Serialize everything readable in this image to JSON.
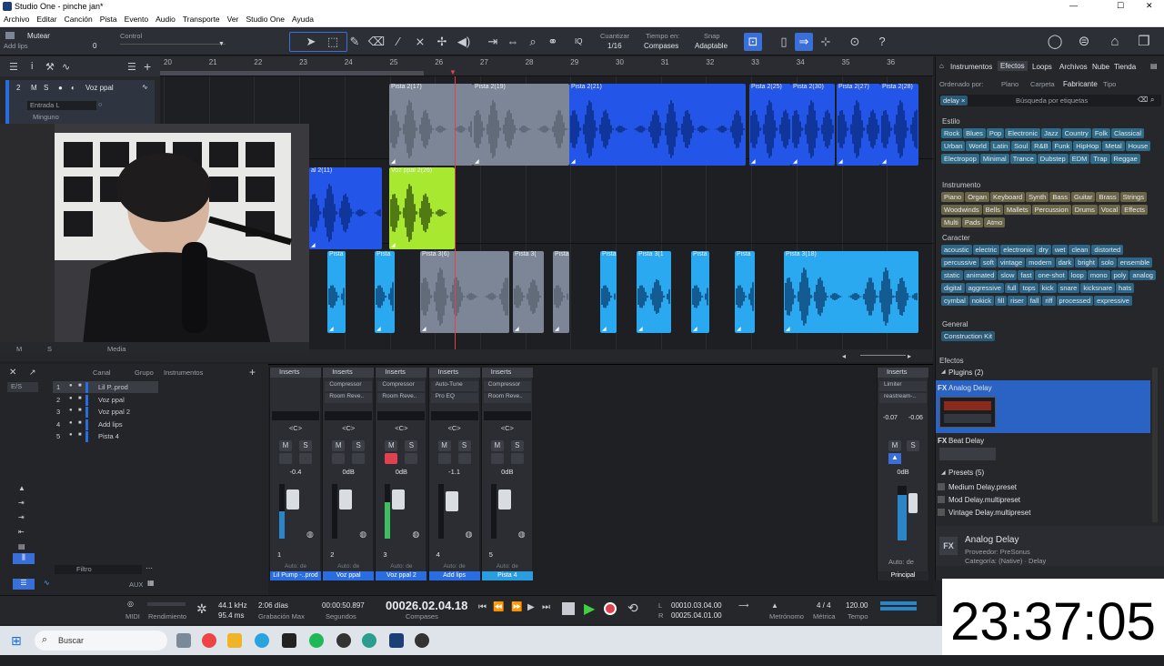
{
  "window": {
    "title": "Studio One - pinche jan*"
  },
  "window_controls": {
    "minimize": "—",
    "maximize": "☐",
    "close": "✕"
  },
  "menu": [
    "Archivo",
    "Editar",
    "Canción",
    "Pista",
    "Evento",
    "Audio",
    "Transporte",
    "Ver",
    "Studio One",
    "Ayuda"
  ],
  "toolbar": {
    "track_label": "Mutear",
    "track_sub": "Add lips",
    "track_val": "0",
    "control_label": "Control",
    "quantize_label": "Cuantizar",
    "quantize_val": "1/16",
    "timebase_label": "Tiempo en:",
    "timebase_val": "Compases",
    "snap_label": "Snap",
    "snap_val": "Adaptable",
    "iq": "IQ",
    "help": "?"
  },
  "track_header": {
    "num": "2",
    "mute": "M",
    "solo": "S",
    "name": "Voz ppal",
    "input": "Entrada L",
    "monitor": "Minguno",
    "bottom": [
      "M",
      "S",
      "Media"
    ]
  },
  "ruler": [
    "20",
    "21",
    "22",
    "23",
    "24",
    "25",
    "26",
    "27",
    "28",
    "29",
    "30",
    "31",
    "32",
    "33",
    "34",
    "35",
    "36"
  ],
  "clips": {
    "track1": [
      "Pista 2(17)",
      "Pista 2(19)",
      "Pista 2(21)",
      "Pista 2(25)",
      "Pista 2(30)",
      "Pista 2(27)",
      "Pista 2(28)"
    ],
    "track2": [
      "al 2(11)",
      "Voz ppal 2(26)"
    ],
    "track3": [
      "Pista",
      "Pista 3(6)",
      "Pista 3(",
      "Pista",
      "Pista 3(1",
      "Pista",
      "Pista",
      "Pista 3(18)"
    ]
  },
  "console_left": {
    "header_canal": "Canal",
    "header_grupo": "Grupo",
    "header_instr": "Instrumentos",
    "es": "E/S",
    "filter_placeholder": "Filtro",
    "aux": "AUX",
    "channels": [
      {
        "num": "1",
        "name": "Lil P..prod"
      },
      {
        "num": "2",
        "name": "Voz ppal"
      },
      {
        "num": "3",
        "name": "Voz ppal 2"
      },
      {
        "num": "4",
        "name": "Add lips"
      },
      {
        "num": "5",
        "name": "Pista 4"
      }
    ]
  },
  "strips": [
    {
      "num": "1",
      "name": "Lil Pump -..prod",
      "gain": "-0.4",
      "inserts": [],
      "color": "#2a6de0"
    },
    {
      "num": "2",
      "name": "Voz ppal",
      "gain": "0dB",
      "inserts": [
        "Compressor",
        "Room Reve.."
      ],
      "color": "#2a6de0"
    },
    {
      "num": "3",
      "name": "Voz ppal 2",
      "gain": "0dB",
      "inserts": [
        "Compressor",
        "Room Reve.."
      ],
      "color": "#2a6de0"
    },
    {
      "num": "4",
      "name": "Add lips",
      "gain": "-1.1",
      "inserts": [
        "Auto-Tune",
        "Pro EQ"
      ],
      "color": "#2a6de0"
    },
    {
      "num": "5",
      "name": "Pista 4",
      "gain": "0dB",
      "inserts": [
        "Compressor",
        "Room Reve.."
      ],
      "color": "#2a9de0"
    }
  ],
  "strip_common": {
    "inserts": "Inserts",
    "pan": "<C>",
    "mute": "M",
    "solo": "S",
    "auto": "Auto: de"
  },
  "master": {
    "inserts": "Inserts",
    "slots": [
      "Limiter",
      "reastream-.."
    ],
    "peak1": "-0.07",
    "peak2": "-0.06",
    "gain": "0dB",
    "name": "Principal",
    "auto": "Auto: de"
  },
  "browser": {
    "tabs": [
      "Instrumentos",
      "Efectos",
      "Loops",
      "Archivos",
      "Nube",
      "Tienda"
    ],
    "sort_label": "Ordenado por:",
    "sort_opts": [
      "Plano",
      "Carpeta",
      "Fabricante",
      "Tipo"
    ],
    "filter_tag": "delay ×",
    "search_placeholder": "Búsqueda por etiquetas",
    "estilo_label": "Estilo",
    "estilo": [
      "Rock",
      "Blues",
      "Pop",
      "Electronic",
      "Jazz",
      "Country",
      "Folk",
      "Classical",
      "Urban",
      "World",
      "Latin",
      "Soul",
      "R&B",
      "Funk",
      "HipHop",
      "Metal",
      "House",
      "Electropop",
      "Minimal",
      "Trance",
      "Dubstep",
      "EDM",
      "Trap",
      "Reggae"
    ],
    "instrumento_label": "Instrumento",
    "instrumento": [
      "Piano",
      "Organ",
      "Keyboard",
      "Synth",
      "Bass",
      "Guitar",
      "Brass",
      "Strings",
      "Woodwinds",
      "Bells",
      "Mallets",
      "Percussion",
      "Drums",
      "Vocal",
      "Effects",
      "Multi",
      "Pads",
      "Atmo"
    ],
    "caracter_label": "Caracter",
    "caracter": [
      "acoustic",
      "electric",
      "electronic",
      "dry",
      "wet",
      "clean",
      "distorted",
      "percussive",
      "soft",
      "vintage",
      "modern",
      "dark",
      "bright",
      "solo",
      "ensemble",
      "static",
      "animated",
      "slow",
      "fast",
      "one-shot",
      "loop",
      "mono",
      "poly",
      "analog",
      "digital",
      "aggressive",
      "full",
      "tops",
      "kick",
      "snare",
      "kicksnare",
      "hats",
      "cymbal",
      "nokick",
      "fill",
      "riser",
      "fall",
      "riff",
      "processed",
      "expressive"
    ],
    "general_label": "General",
    "general": [
      "Construction Kit"
    ],
    "efectos_label": "Efectos",
    "plugins_label": "Plugins (2)",
    "plugins": [
      "Analog Delay",
      "Beat Delay"
    ],
    "fx": "FX",
    "presets_label": "Presets (5)",
    "presets": [
      "Medium Delay.preset",
      "Mod Delay.multipreset",
      "Vintage Delay.multipreset"
    ],
    "info_name": "Analog Delay",
    "info_vendor": "Proveedor:   PreSonus",
    "info_cat": "Categoría:   (Native) · Delay"
  },
  "transport": {
    "midi": "MIDI",
    "rendimiento": "Rendimiento",
    "khz": "44.1 kHz",
    "ms": "95.4 ms",
    "dias": "2:06 días",
    "grabmax": "Grabación Max",
    "seconds": "00:00:50.897",
    "seconds_label": "Segundos",
    "position": "00026.02.04.18",
    "position_label": "Compases",
    "L": "L",
    "R": "R",
    "loop_l": "00010.03.04.00",
    "loop_r": "00025.04.01.00",
    "metronomo": "Metrónomo",
    "metrica": "Métrica",
    "metrica_val": "4 / 4",
    "tempo": "Tempo",
    "tempo_val": "120.00"
  },
  "taskbar": {
    "search": "Buscar"
  },
  "clock": "23:37:05",
  "colors": {
    "accent": "#3a6fd8",
    "clip_blue": "#2255e8",
    "clip_gray": "#7c8696",
    "clip_lime": "#a8e830",
    "clip_cyan": "#2aa8f0"
  }
}
